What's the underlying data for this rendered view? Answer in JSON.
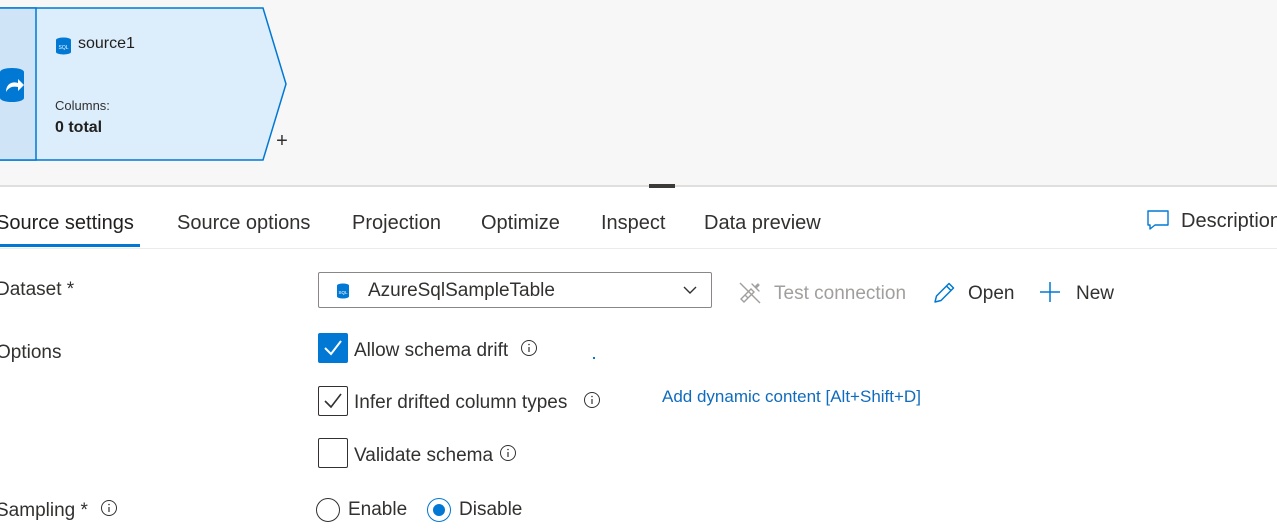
{
  "node": {
    "title": "source1",
    "columns_label": "Columns:",
    "columns_value": "0 total",
    "add_symbol": "+",
    "fill_color": "#dcedfb",
    "stroke_color": "#0078d4"
  },
  "tabs": [
    {
      "label": "Source settings",
      "active": true
    },
    {
      "label": "Source options",
      "active": false
    },
    {
      "label": "Projection",
      "active": false
    },
    {
      "label": "Optimize",
      "active": false
    },
    {
      "label": "Inspect",
      "active": false
    },
    {
      "label": "Data preview",
      "active": false
    }
  ],
  "description_label": "Description",
  "form": {
    "dataset_label": "Dataset *",
    "dataset_value": "AzureSqlSampleTable",
    "test_connection_label": "Test connection",
    "open_label": "Open",
    "new_label": "New",
    "options_label": "Options",
    "allow_schema_drift": {
      "label": "Allow schema drift",
      "checked": true
    },
    "infer_drifted_types": {
      "label": "Infer drifted column types",
      "checked": true
    },
    "validate_schema": {
      "label": "Validate schema",
      "checked": false
    },
    "dynamic_content_link": "Add dynamic content [Alt+Shift+D]",
    "sampling_label": "Sampling *",
    "sampling_options": [
      {
        "label": "Enable",
        "selected": false
      },
      {
        "label": "Disable",
        "selected": true
      }
    ]
  },
  "colors": {
    "accent": "#0078d4",
    "link": "#0f6cbd",
    "disabled_text": "#a19f9d"
  },
  "icons": {
    "sql": "sql-database-icon",
    "chevron": "chevron-down-icon",
    "plug": "plug-disconnected-icon",
    "pencil": "pencil-icon",
    "plus": "plus-icon",
    "comment": "comment-icon",
    "info": "info-icon"
  }
}
